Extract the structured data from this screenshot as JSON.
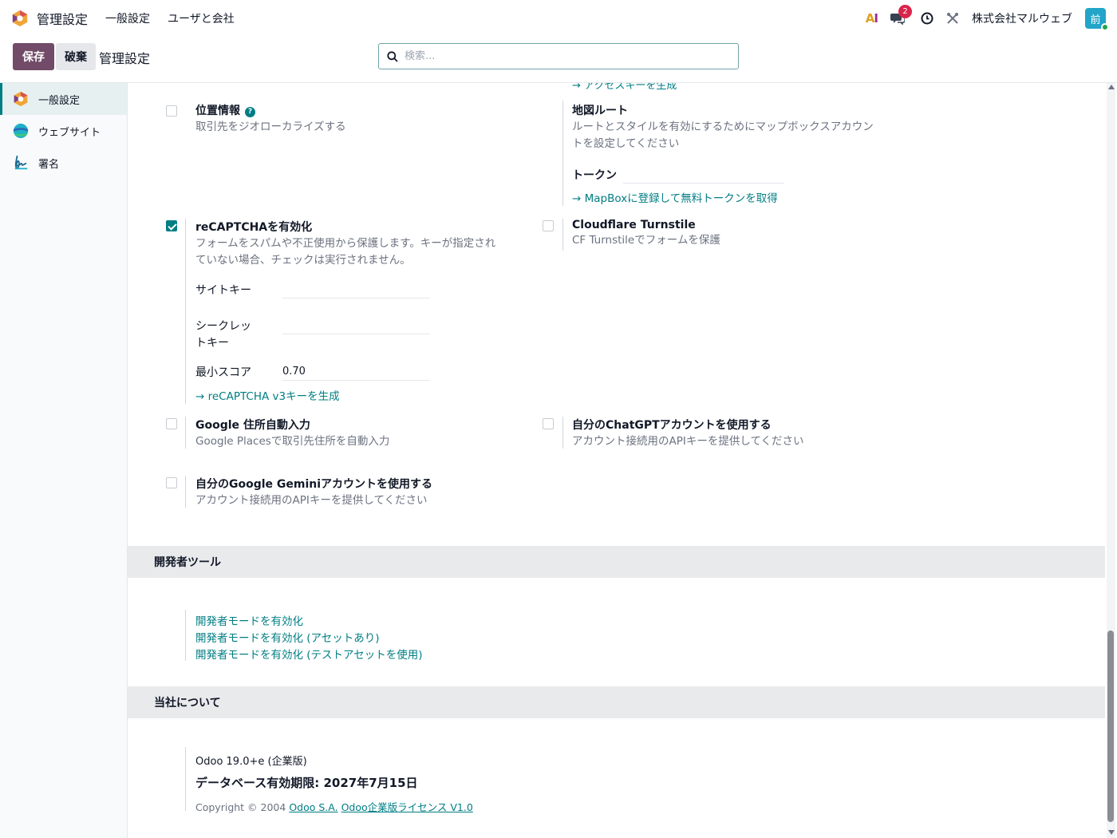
{
  "navbar": {
    "app_title": "管理設定",
    "menu": [
      "一般設定",
      "ユーザと会社"
    ],
    "ai_label_a": "A",
    "ai_label_i": "I",
    "chat_badge": "2",
    "company": "株式会社マルウェブ",
    "avatar_initial": "前"
  },
  "control": {
    "save_label": "保存",
    "discard_label": "破棄",
    "breadcrumb": "管理設定",
    "search_placeholder": "検索..."
  },
  "sidebar": {
    "items": [
      {
        "label": "一般設定",
        "icon": "settings-app-icon"
      },
      {
        "label": "ウェブサイト",
        "icon": "website-app-icon"
      },
      {
        "label": "署名",
        "icon": "sign-app-icon"
      }
    ]
  },
  "settings": {
    "cut_link": "→ アクセスキーを生成",
    "geolocation": {
      "title": "位置情報",
      "desc": "取引先をジオローカライズする",
      "checked": false
    },
    "map_routes": {
      "title": "地図ルート",
      "desc_line1": "ルートとスタイルを有効にするためにマップボックスアカウン",
      "desc_line2": "トを設定してください",
      "token_label": "トークン",
      "token_value": "",
      "link": "→ MapBoxに登録して無料トークンを取得"
    },
    "recaptcha": {
      "title": "reCAPTCHAを有効化",
      "desc_line1": "フォームをスパムや不正使用から保護します。キーが指定され",
      "desc_line2": "ていない場合、チェックは実行されません。",
      "checked": true,
      "site_key_label": "サイトキー",
      "site_key_value": "",
      "secret_key_label_line1": "シークレッ",
      "secret_key_label_line2": "トキー",
      "secret_key_value": "",
      "min_score_label": "最小スコア",
      "min_score_value": "0.70",
      "link": "→ reCAPTCHA v3キーを生成"
    },
    "cloudflare": {
      "title": "Cloudflare Turnstile",
      "desc": "CF Turnstileでフォームを保護",
      "checked": false
    },
    "google_address": {
      "title": "Google 住所自動入力",
      "desc": "Google Placesで取引先住所を自動入力",
      "checked": false
    },
    "chatgpt": {
      "title": "自分のChatGPTアカウントを使用する",
      "desc": "アカウント接続用のAPIキーを提供してください",
      "checked": false
    },
    "gemini": {
      "title": "自分のGoogle Geminiアカウントを使用する",
      "desc": "アカウント接続用のAPIキーを提供してください",
      "checked": false
    }
  },
  "developer": {
    "section_title": "開発者ツール",
    "links": [
      "開発者モードを有効化",
      "開発者モードを有効化 (アセットあり)",
      "開発者モードを有効化 (テストアセットを使用)"
    ]
  },
  "about": {
    "section_title": "当社について",
    "version": "Odoo 19.0+e (企業版)",
    "expiry": "データベース有効期限: 2027年7月15日",
    "copyright_prefix": "Copyright © 2004",
    "copyright_company": "Odoo S.A.",
    "license": "Odoo企業版ライセンス V1.0"
  }
}
